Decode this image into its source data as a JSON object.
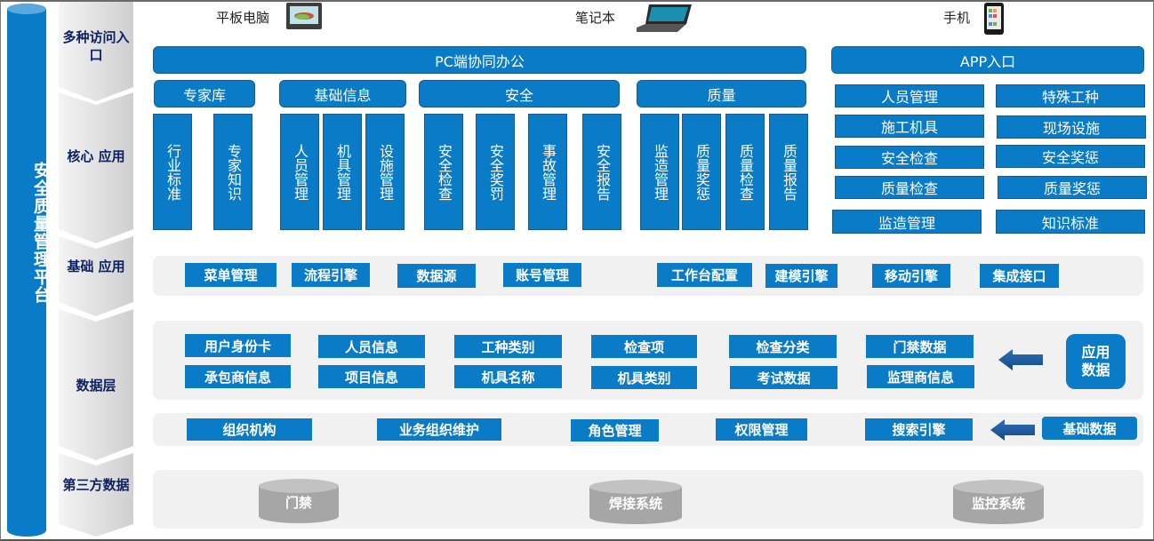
{
  "platform_title": "安全质量管理平台",
  "layers": [
    {
      "id": "access",
      "label": "多种访问入口"
    },
    {
      "id": "core",
      "label": "核心 应用"
    },
    {
      "id": "base",
      "label": "基础 应用"
    },
    {
      "id": "data",
      "label": "数据层"
    },
    {
      "id": "third",
      "label": "第三方数据"
    }
  ],
  "devices": [
    {
      "label": "平板电脑",
      "icon": "tablet-icon"
    },
    {
      "label": "笔记本",
      "icon": "laptop-icon"
    },
    {
      "label": "手机",
      "icon": "phone-icon"
    }
  ],
  "pc_entry": "PC端协同办公",
  "app_entry": "APP入口",
  "core_groups": [
    {
      "title": "专家库",
      "items": [
        "行业标准",
        "专家知识"
      ]
    },
    {
      "title": "基础信息",
      "items": [
        "人员管理",
        "机具管理",
        "设施管理"
      ]
    },
    {
      "title": "安全",
      "items": [
        "安全检查",
        "安全奖罚",
        "事故管理",
        "安全报告"
      ]
    },
    {
      "title": "质量",
      "items": [
        "监造管理",
        "质量奖惩",
        "质量检查",
        "质量报告"
      ]
    }
  ],
  "app_items": [
    [
      "人员管理",
      "特殊工种"
    ],
    [
      "施工机具",
      "现场设施"
    ],
    [
      "安全检查",
      "安全奖惩"
    ],
    [
      "质量检查",
      "质量奖惩"
    ],
    [
      "监造管理",
      "知识标准"
    ]
  ],
  "base_apps": [
    "菜单管理",
    "流程引擎",
    "数据源",
    "账号管理",
    "工作台配置",
    "建模引擎",
    "移动引擎",
    "集成接口"
  ],
  "app_data": {
    "label": "应用数据",
    "row1": [
      "用户身份卡",
      "人员信息",
      "工种类别",
      "检查项",
      "检查分类",
      "门禁数据"
    ],
    "row2": [
      "承包商信息",
      "项目信息",
      "机具名称",
      "机具类别",
      "考试数据",
      "监理商信息"
    ]
  },
  "base_data": {
    "label": "基础数据",
    "items": [
      "组织机构",
      "业务组织维护",
      "角色管理",
      "权限管理",
      "搜索引擎"
    ]
  },
  "third_party": [
    "门禁",
    "焊接系统",
    "监控系统"
  ],
  "colors": {
    "primary": "#0a7bc6",
    "layer_text": "#0d2163",
    "band": "#f1f1f1",
    "db": "#a6a6a6"
  }
}
